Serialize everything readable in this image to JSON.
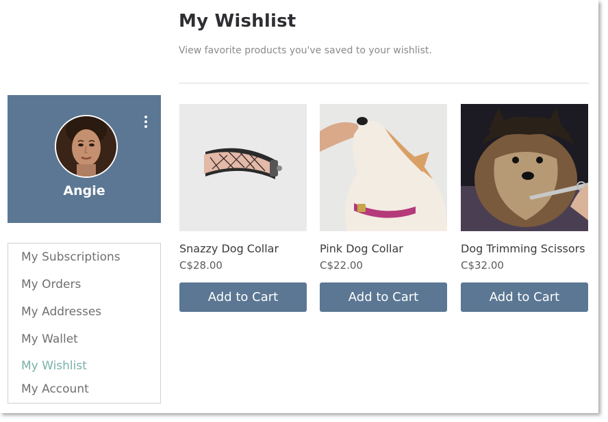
{
  "header": {
    "title": "My Wishlist",
    "subtitle": "View favorite products you've saved to your wishlist."
  },
  "profile": {
    "name": "Angie",
    "menu_icon": "more-vertical-icon"
  },
  "sidebar": {
    "items": [
      {
        "label": "My Subscriptions",
        "active": false
      },
      {
        "label": "My Orders",
        "active": false
      },
      {
        "label": "My Addresses",
        "active": false
      },
      {
        "label": "My Wallet",
        "active": false
      },
      {
        "label": "My Wishlist",
        "active": true
      },
      {
        "label": "My Account",
        "active": false
      }
    ]
  },
  "products": [
    {
      "name": "Snazzy Dog Collar",
      "price": "C$28.00",
      "button": "Add to Cart"
    },
    {
      "name": "Pink Dog Collar",
      "price": "C$22.00",
      "button": "Add to Cart"
    },
    {
      "name": "Dog Trimming Scissors",
      "price": "C$32.00",
      "button": "Add to Cart"
    }
  ],
  "colors": {
    "accent": "#5b7793",
    "active_link": "#7ab0a8"
  }
}
